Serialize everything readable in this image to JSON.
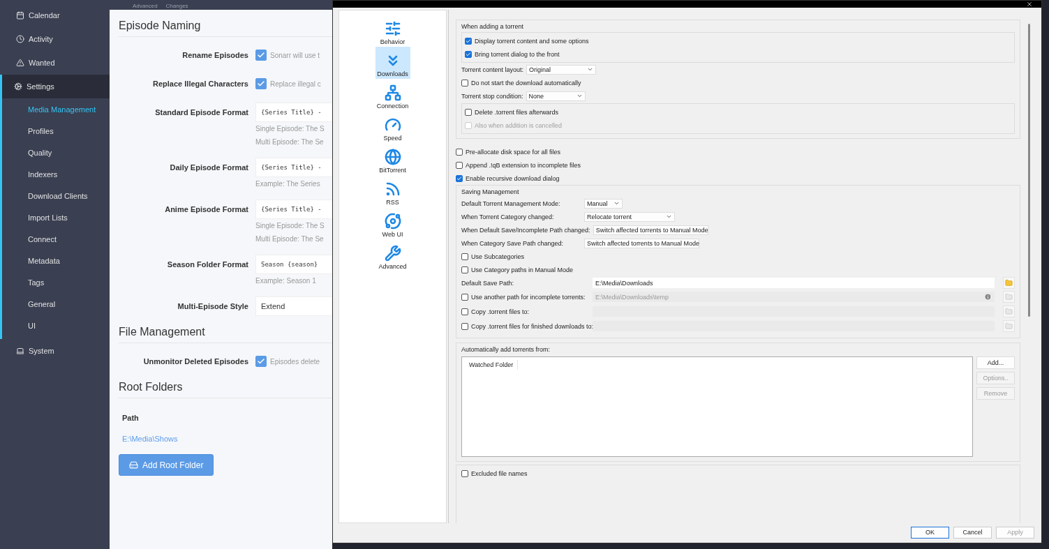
{
  "sidebar": {
    "items": [
      {
        "label": "Calendar",
        "selected": false
      },
      {
        "label": "Activity",
        "selected": false
      },
      {
        "label": "Wanted",
        "selected": false
      },
      {
        "label": "Settings",
        "selected": true,
        "children": [
          {
            "label": "Media Management",
            "selected": true
          },
          {
            "label": "Profiles",
            "selected": false
          },
          {
            "label": "Quality",
            "selected": false
          },
          {
            "label": "Indexers",
            "selected": false
          },
          {
            "label": "Download Clients",
            "selected": false
          },
          {
            "label": "Import Lists",
            "selected": false
          },
          {
            "label": "Connect",
            "selected": false
          },
          {
            "label": "Metadata",
            "selected": false
          },
          {
            "label": "Tags",
            "selected": false
          },
          {
            "label": "General",
            "selected": false
          },
          {
            "label": "UI",
            "selected": false
          }
        ]
      },
      {
        "label": "System",
        "selected": false
      }
    ]
  },
  "toolbar": [
    "Advanced",
    "Changes"
  ],
  "sections": [
    {
      "title": "Episode Naming",
      "rows": [
        {
          "kind": "checkbox",
          "label": "Rename Episodes",
          "checked": true,
          "text": "Sonarr will use t"
        },
        {
          "kind": "checkbox",
          "label": "Replace Illegal Characters",
          "checked": true,
          "text": "Replace illegal c"
        },
        {
          "kind": "input",
          "label": "Standard Episode Format",
          "value": "{Series Title} -",
          "help": [
            "Single Episode: The S",
            "Multi Episode: The Se"
          ]
        },
        {
          "kind": "input",
          "label": "Daily Episode Format",
          "value": "{Series Title} -",
          "help": [
            "Example: The Series"
          ]
        },
        {
          "kind": "input",
          "label": "Anime Episode Format",
          "value": "{Series Title} -",
          "help": [
            "Single Episode: The S",
            "Multi Episode: The Se"
          ]
        },
        {
          "kind": "input",
          "label": "Season Folder Format",
          "value": "Season {season}",
          "help": [
            "Example: Season 1"
          ]
        },
        {
          "kind": "select",
          "label": "Multi-Episode Style",
          "value": "Extend"
        }
      ]
    },
    {
      "title": "File Management",
      "rows": [
        {
          "kind": "checkbox",
          "label": "Unmonitor Deleted Episodes",
          "checked": true,
          "text": "Episodes delete"
        }
      ]
    }
  ],
  "root_folders": {
    "title": "Root Folders",
    "column": "Path",
    "rows": [
      "E:\\Media\\Shows"
    ],
    "button": "Add Root Folder"
  },
  "dialog": {
    "categories": [
      {
        "label": "Behavior",
        "selected": false
      },
      {
        "label": "Downloads",
        "selected": true
      },
      {
        "label": "Connection",
        "selected": false
      },
      {
        "label": "Speed",
        "selected": false
      },
      {
        "label": "BitTorrent",
        "selected": false
      },
      {
        "label": "RSS",
        "selected": false
      },
      {
        "label": "Web UI",
        "selected": false
      },
      {
        "label": "Advanced",
        "selected": false
      }
    ],
    "adding": {
      "title": "When adding a torrent",
      "options": [
        {
          "label": "Display torrent content and some options",
          "checked": true
        },
        {
          "label": "Bring torrent dialog to the front",
          "checked": true
        }
      ]
    },
    "content_layout": {
      "label": "Torrent content layout:",
      "value": "Original"
    },
    "no_autostart": {
      "label": "Do not start the download automatically",
      "checked": false
    },
    "stop_condition": {
      "label": "Torrent stop condition:",
      "value": "None"
    },
    "delete_options": [
      {
        "label": "Delete .torrent files afterwards",
        "checked": false,
        "disabled": false
      },
      {
        "label": "Also when addition is cancelled",
        "checked": false,
        "disabled": true
      }
    ],
    "checks": [
      {
        "label": "Pre-allocate disk space for all files",
        "checked": false
      },
      {
        "label": "Append .!qB extension to incomplete files",
        "checked": false
      },
      {
        "label": "Enable recursive download dialog",
        "checked": true
      }
    ],
    "saving": {
      "title": "Saving Management",
      "selects": [
        {
          "label": "Default Torrent Management Mode:",
          "value": "Manual"
        },
        {
          "label": "When Torrent Category changed:",
          "value": "Relocate torrent"
        },
        {
          "label": "When Default Save/Incomplete Path changed:",
          "value": "Switch affected torrents to Manual Mode"
        },
        {
          "label": "When Category Save Path changed:",
          "value": "Switch affected torrents to Manual Mode"
        }
      ],
      "checks": [
        {
          "label": "Use Subcategories",
          "checked": false
        },
        {
          "label": "Use Category paths in Manual Mode",
          "checked": false
        }
      ],
      "save_path": {
        "label": "Default Save Path:",
        "value": "E:\\Media\\Downloads"
      },
      "paths": [
        {
          "label": "Use another path for incomplete torrents:",
          "checked": false,
          "value": "E:\\Media\\Downloads\\temp",
          "info": true
        },
        {
          "label": "Copy .torrent files to:",
          "checked": false,
          "info": false
        },
        {
          "label": "Copy .torrent files for finished downloads to:",
          "checked": false,
          "info": false
        }
      ]
    },
    "watch": {
      "title": "Automatically add torrents from:",
      "column": "Watched Folder",
      "buttons": [
        {
          "label": "Add...",
          "disabled": false
        },
        {
          "label": "Options..",
          "disabled": true
        },
        {
          "label": "Remove",
          "disabled": true
        }
      ]
    },
    "excluded": {
      "label": "Excluded file names",
      "checked": false
    },
    "buttons": [
      {
        "label": "OK",
        "default": true,
        "disabled": false
      },
      {
        "label": "Cancel",
        "default": false,
        "disabled": false
      },
      {
        "label": "Apply",
        "default": false,
        "disabled": true
      }
    ]
  }
}
